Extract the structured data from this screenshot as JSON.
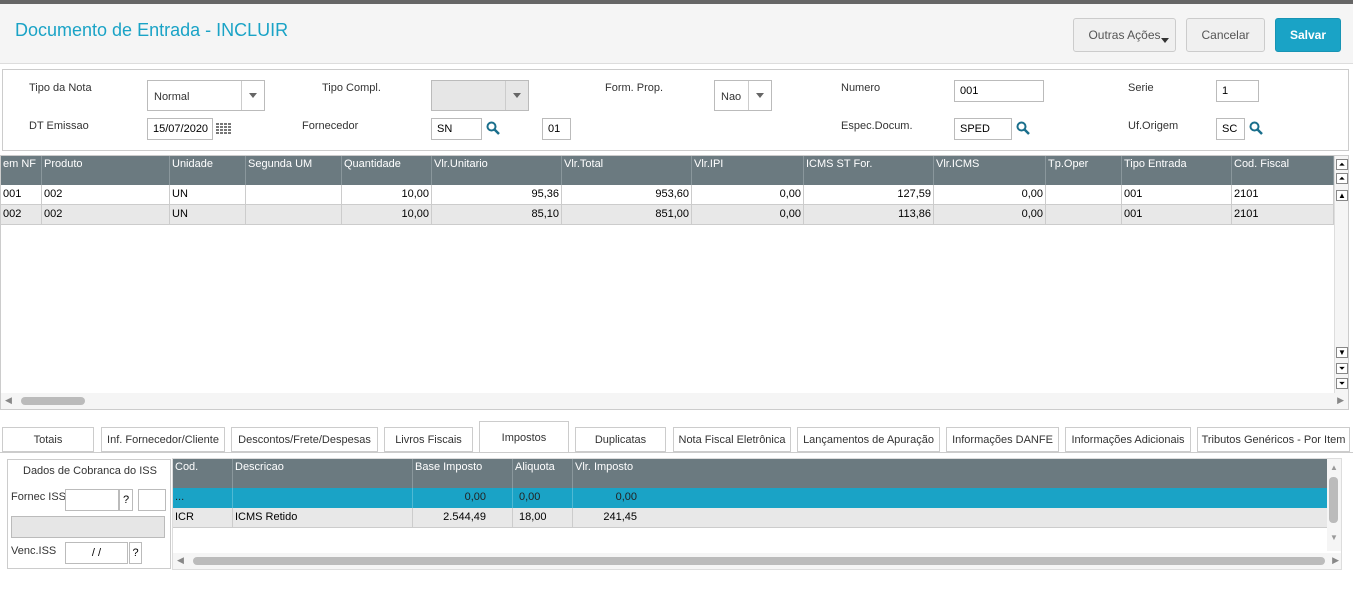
{
  "header": {
    "title": "Documento de Entrada - INCLUIR",
    "more_actions": "Outras Ações",
    "cancel": "Cancelar",
    "save": "Salvar"
  },
  "form": {
    "tipo_nota_label": "Tipo da Nota",
    "tipo_nota_value": "Normal",
    "tipo_compl_label": "Tipo Compl.",
    "tipo_compl_value": "",
    "form_prop_label": "Form. Prop.",
    "form_prop_value": "Nao",
    "numero_label": "Numero",
    "numero_value": "001",
    "serie_label": "Serie",
    "serie_value": "1",
    "dt_emissao_label": "DT Emissao",
    "dt_emissao_value": "15/07/2020",
    "fornecedor_label": "Fornecedor",
    "fornecedor_value": "SN",
    "loja_value": "01",
    "espec_label": "Espec.Docum.",
    "espec_value": "SPED",
    "uf_label": "Uf.Origem",
    "uf_value": "SC"
  },
  "items_grid": {
    "columns": [
      "em NF",
      "Produto",
      "Unidade",
      "Segunda UM",
      "Quantidade",
      "Vlr.Unitario",
      "Vlr.Total",
      "Vlr.IPI",
      "ICMS ST For.",
      "Vlr.ICMS",
      "Tp.Oper",
      "Tipo Entrada",
      "Cod. Fiscal"
    ],
    "rows": [
      [
        "001",
        "002",
        "UN",
        "",
        "10,00",
        "95,36",
        "953,60",
        "0,00",
        "127,59",
        "0,00",
        "",
        "001",
        "2101"
      ],
      [
        "002",
        "002",
        "UN",
        "",
        "10,00",
        "85,10",
        "851,00",
        "0,00",
        "113,86",
        "0,00",
        "",
        "001",
        "2101"
      ]
    ]
  },
  "tabs": [
    "Totais",
    "Inf. Fornecedor/Cliente",
    "Descontos/Frete/Despesas",
    "Livros Fiscais",
    "Impostos",
    "Duplicatas",
    "Nota Fiscal Eletrônica",
    "Lançamentos de Apuração",
    "Informações DANFE",
    "Informações Adicionais",
    "Tributos Genéricos - Por Item"
  ],
  "active_tab": "Impostos",
  "iss": {
    "title": "Dados de Cobranca do ISS",
    "fornec_label": "Fornec ISS",
    "fornec_value": "",
    "help": "?",
    "venc_label": "Venc.ISS",
    "venc_value": "/ /"
  },
  "tax_grid": {
    "columns": [
      "Cod.",
      "Descricao",
      "Base Imposto",
      "Aliquota",
      "Vlr. Imposto"
    ],
    "rows": [
      [
        "...",
        "",
        "0,00",
        "0,00",
        "0,00"
      ],
      [
        "ICR",
        "ICMS Retido",
        "2.544,49",
        "18,00",
        "241,45"
      ]
    ]
  },
  "colors": {
    "accent": "#1aa3c6",
    "grid_header": "#6b7a80",
    "selected_row": "#1aa3c6"
  }
}
